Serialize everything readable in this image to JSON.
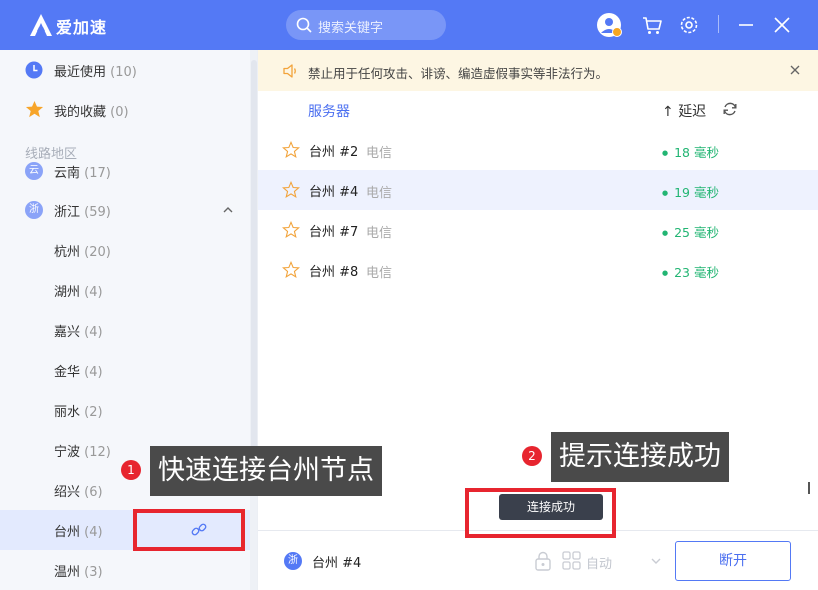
{
  "app": {
    "title": "爱加速"
  },
  "search": {
    "placeholder": "搜索关键字"
  },
  "sidebar": {
    "recent": {
      "label": "最近使用",
      "count": "(10)"
    },
    "favorites": {
      "label": "我的收藏",
      "count": "(0)"
    },
    "section_label": "线路地区",
    "partial_row": {
      "icon": "云",
      "label": "云南",
      "count": "(17)"
    },
    "province": {
      "icon": "浙",
      "label": "浙江",
      "count": "(59)"
    },
    "cities": [
      {
        "label": "杭州",
        "count": "(20)"
      },
      {
        "label": "湖州",
        "count": "(4)"
      },
      {
        "label": "嘉兴",
        "count": "(4)"
      },
      {
        "label": "金华",
        "count": "(4)"
      },
      {
        "label": "丽水",
        "count": "(2)"
      },
      {
        "label": "宁波",
        "count": "(12)"
      },
      {
        "label": "绍兴",
        "count": "(6)"
      },
      {
        "label": "台州",
        "count": "(4)"
      },
      {
        "label": "温州",
        "count": "(3)"
      }
    ],
    "selected_city": "台州"
  },
  "notice": {
    "text": "禁止用于任何攻击、诽谤、编造虚假事实等非法行为。"
  },
  "table": {
    "col_server": "服务器",
    "col_latency": "延迟",
    "rows": [
      {
        "name": "台州 #2",
        "isp": "电信",
        "latency": "18 毫秒"
      },
      {
        "name": "台州 #4",
        "isp": "电信",
        "latency": "19 毫秒"
      },
      {
        "name": "台州 #7",
        "isp": "电信",
        "latency": "25 毫秒"
      },
      {
        "name": "台州 #8",
        "isp": "电信",
        "latency": "23 毫秒"
      }
    ]
  },
  "bottom": {
    "province_icon": "浙",
    "server": "台州 #4",
    "mode": "自动",
    "disconnect": "断开"
  },
  "tooltip": "连接成功",
  "annotations": [
    {
      "num": "1",
      "text": "快速连接台州节点"
    },
    {
      "num": "2",
      "text": "提示连接成功"
    }
  ],
  "colors": {
    "brand": "#5479f5",
    "latency_good": "#22b573",
    "annotation_red": "#e7252f",
    "notice_bg": "#fdf6e3"
  }
}
